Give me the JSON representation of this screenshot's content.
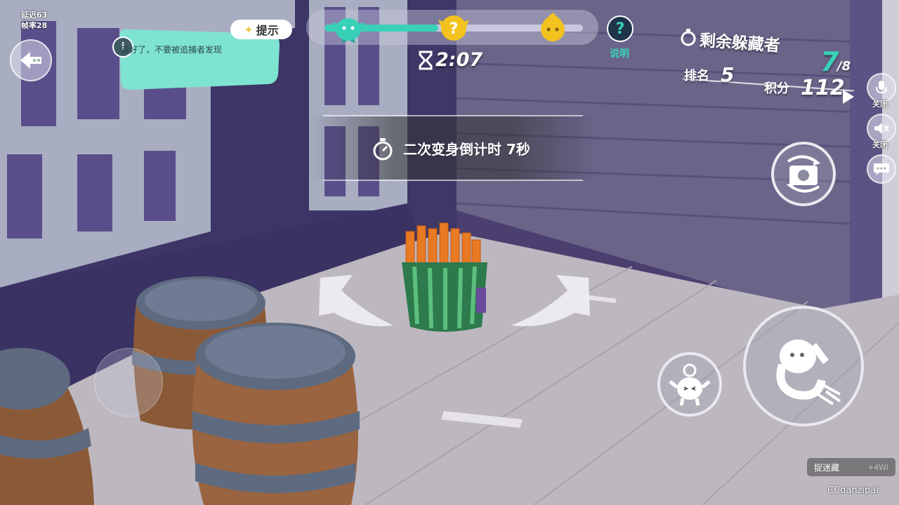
{
  "stats": {
    "latency": "延迟63",
    "framerate": "帧率28"
  },
  "hint": {
    "tag": "提示",
    "info_symbol": "i",
    "message": "躲好了，不要被追捕者发现"
  },
  "progress": {
    "fill_fraction": 0.44,
    "markers": [
      "hider-mascot-icon",
      "question-mascot-icon",
      "catcher-mascot-icon"
    ]
  },
  "timer": {
    "value": "2:07"
  },
  "help": {
    "symbol": "?",
    "label": "说明"
  },
  "score": {
    "remaining_title": "剩余躲藏者",
    "remaining_count": "7",
    "remaining_total": "/8",
    "rank_label": "排名",
    "rank_value": "5",
    "points_label": "积分",
    "points_value": "112"
  },
  "side_controls": {
    "mic_label": "关闭",
    "sound_label": "关闭"
  },
  "banner": {
    "text": "二次变身倒计时 7秒"
  },
  "catch_button": {
    "label": "捉迷藏",
    "bonus": "+4Wi"
  },
  "watermark": "CCdanzipai",
  "colors": {
    "accent": "#39d0b8",
    "wall": "#4a3f6e",
    "floor": "#bdb8c0",
    "hint_bg": "#7fe3d2"
  }
}
